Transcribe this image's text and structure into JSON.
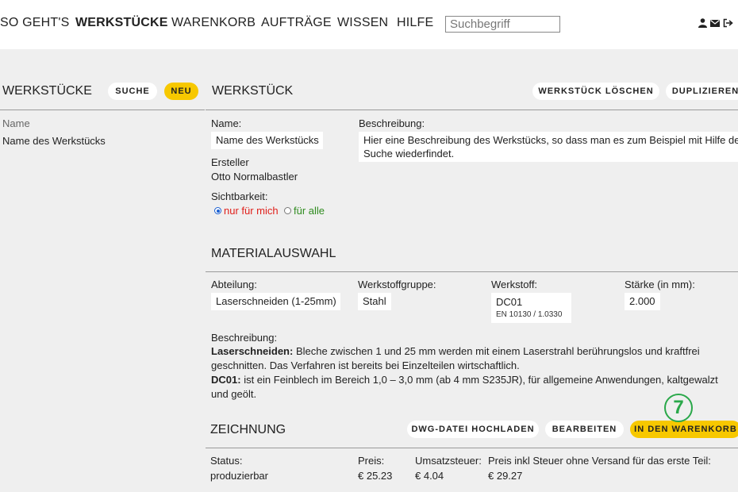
{
  "nav": {
    "items": [
      "SO GEHT'S",
      "WERKSTÜCKE",
      "WARENKORB",
      "AUFTRÄGE",
      "WISSEN",
      "HILFE"
    ],
    "active": "WERKSTÜCKE",
    "search_placeholder": "Suchbegriff",
    "icons": [
      "user-icon",
      "mail-icon",
      "logout-icon"
    ]
  },
  "sidebar": {
    "title": "WERKSTÜCKE",
    "search_button": "SUCHE",
    "new_button": "NEU",
    "column_label": "Name",
    "items": [
      "Name des Werkstücks"
    ]
  },
  "werkstueck": {
    "title": "WERKSTÜCK",
    "delete_button": "WERKSTÜCK LÖSCHEN",
    "duplicate_button": "DUPLIZIEREN",
    "name_label": "Name:",
    "name_value": "Name des Werkstücks",
    "description_label": "Beschreibung:",
    "description_line1": "Hier eine Beschreibung des Werkstücks, so dass man es zum Beispiel mit Hilfe der",
    "description_line2": "Suche wiederfindet.",
    "creator_label": "Ersteller",
    "creator_value": "Otto Normalbastler",
    "visibility_label": "Sichtbarkeit:",
    "visibility_options": [
      "nur für mich",
      "für alle"
    ],
    "visibility_selected": "nur für mich"
  },
  "material": {
    "title": "MATERIALAUSWAHL",
    "department_label": "Abteilung:",
    "department_value": "Laserschneiden (1-25mm)",
    "group_label": "Werkstoffgruppe:",
    "group_value": "Stahl",
    "material_label": "Werkstoff:",
    "material_value": "DC01",
    "material_norm": "EN 10130 / 1.0330",
    "thickness_label": "Stärke (in mm):",
    "thickness_value": "2.000",
    "description_label": "Beschreibung:",
    "desc1_bold": "Laserschneiden:",
    "desc1_line1": " Bleche zwischen 1 und 25 mm werden mit einem Laserstrahl berührungslos und kraftfrei",
    "desc1_line2": "geschnitten. Das Verfahren ist bereits bei Einzelteilen wirtschaftlich.",
    "desc2_bold": "DC01:",
    "desc2_line1": " ist ein Feinblech im Bereich 1,0 – 3,0 mm (ab 4 mm S235JR), für allgemeine Anwendungen, kaltgewalzt",
    "desc2_line2": "und geölt."
  },
  "zeichnung": {
    "title": "ZEICHNUNG",
    "upload_button": "DWG-DATEI HOCHLADEN",
    "edit_button": "BEARBEITEN",
    "cart_button": "IN DEN WARENKORB",
    "marker_number": "7",
    "status_label": "Status:",
    "status_value": "produzierbar",
    "price_label": "Preis:",
    "price_value": "€ 25.23",
    "tax_label": "Umsatzsteuer:",
    "tax_value": "€ 4.04",
    "total_label": "Preis inkl Steuer ohne Versand für das erste Teil:",
    "total_value": "€ 29.27"
  },
  "colors": {
    "accent": "#f7c800",
    "visibility_private": "#e0201b",
    "visibility_public": "#2e8b1e",
    "marker": "#2aa84a"
  }
}
